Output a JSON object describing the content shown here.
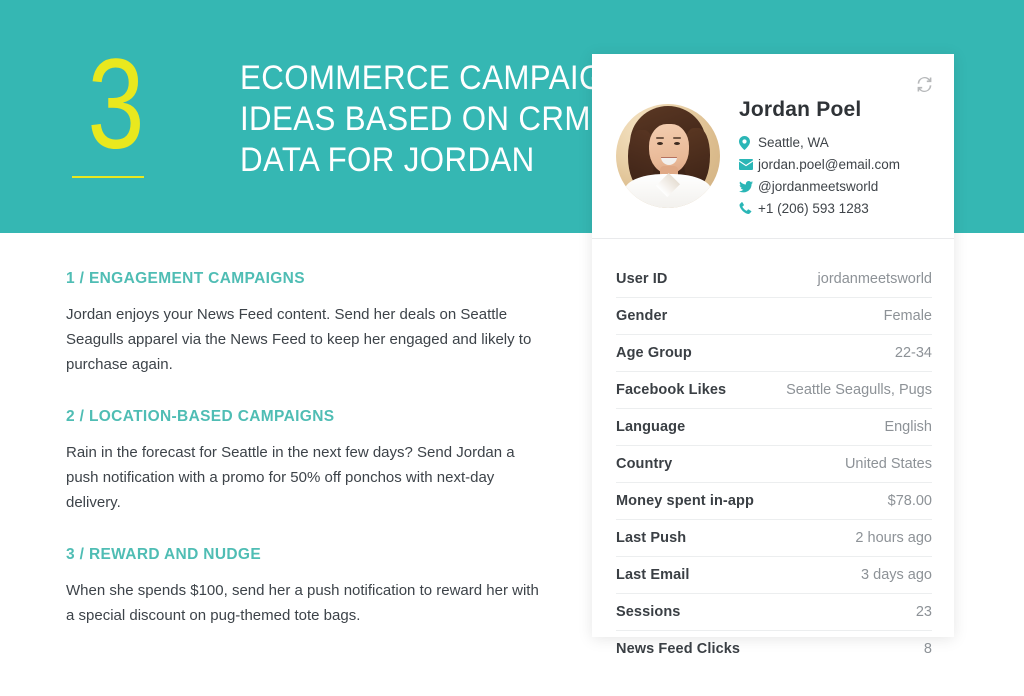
{
  "header": {
    "numeral": "3",
    "title": "Ecommerce Campaign\nIdeas Based on CRM\nData for Jordan",
    "accent_yellow": "#E9E81E",
    "band_color": "#35B7B3"
  },
  "sections": [
    {
      "heading": "1 / Engagement Campaigns",
      "body": "Jordan enjoys your News Feed content. Send her deals on Seattle Seagulls apparel via the News Feed to keep her engaged and likely to purchase again."
    },
    {
      "heading": "2 / Location-Based Campaigns",
      "body": "Rain in the forecast for Seattle in the next few days? Send Jordan a push notification with a promo for 50% off ponchos with next-day delivery."
    },
    {
      "heading": "3 / Reward and Nudge",
      "body": "When she spends $100, send her a push notification to reward her with a special discount on pug-themed tote bags."
    }
  ],
  "profile": {
    "name": "Jordan Poel",
    "avatar_alt": "Portrait of smiling woman with brown hair in white shirt",
    "refresh_label": "refresh-icon",
    "contacts": [
      {
        "icon": "location-pin-icon",
        "value": "Seattle, WA"
      },
      {
        "icon": "envelope-icon",
        "value": "jordan.poel@email.com"
      },
      {
        "icon": "twitter-bird-icon",
        "value": "@jordanmeetsworld"
      },
      {
        "icon": "phone-icon",
        "value": "+1 (206) 593 1283"
      }
    ],
    "accent_color": "#2AB6B6"
  },
  "crm_table": {
    "rows": [
      {
        "label": "User ID",
        "value": "jordanmeetsworld"
      },
      {
        "label": "Gender",
        "value": "Female"
      },
      {
        "label": "Age Group",
        "value": "22-34"
      },
      {
        "label": "Facebook Likes",
        "value": "Seattle Seagulls, Pugs"
      },
      {
        "label": "Language",
        "value": "English"
      },
      {
        "label": "Country",
        "value": "United States"
      },
      {
        "label": "Money spent in-app",
        "value": "$78.00"
      },
      {
        "label": "Last Push",
        "value": "2 hours ago"
      },
      {
        "label": "Last Email",
        "value": "3 days ago"
      },
      {
        "label": "Sessions",
        "value": "23"
      },
      {
        "label": "News Feed Clicks",
        "value": "8"
      }
    ]
  }
}
